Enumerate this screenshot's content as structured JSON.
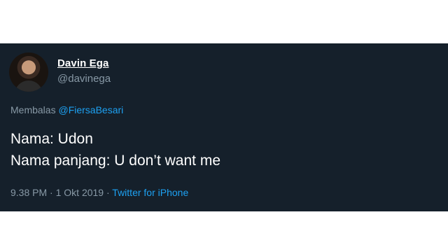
{
  "tweet": {
    "author_name": "Davin Ega",
    "author_handle": "@davinega",
    "reply_prefix": "Membalas",
    "reply_to": "@FiersaBesari",
    "lines": [
      "Nama: Udon",
      "Nama panjang: U don’t want me"
    ],
    "time": "9.38 PM",
    "separator": "·",
    "date": "1 Okt 2019",
    "source": "Twitter for iPhone"
  },
  "colors": {
    "card_background": "#15202b",
    "primary_text": "#ffffff",
    "secondary_text": "#8899a6",
    "accent": "#1da1f2"
  }
}
